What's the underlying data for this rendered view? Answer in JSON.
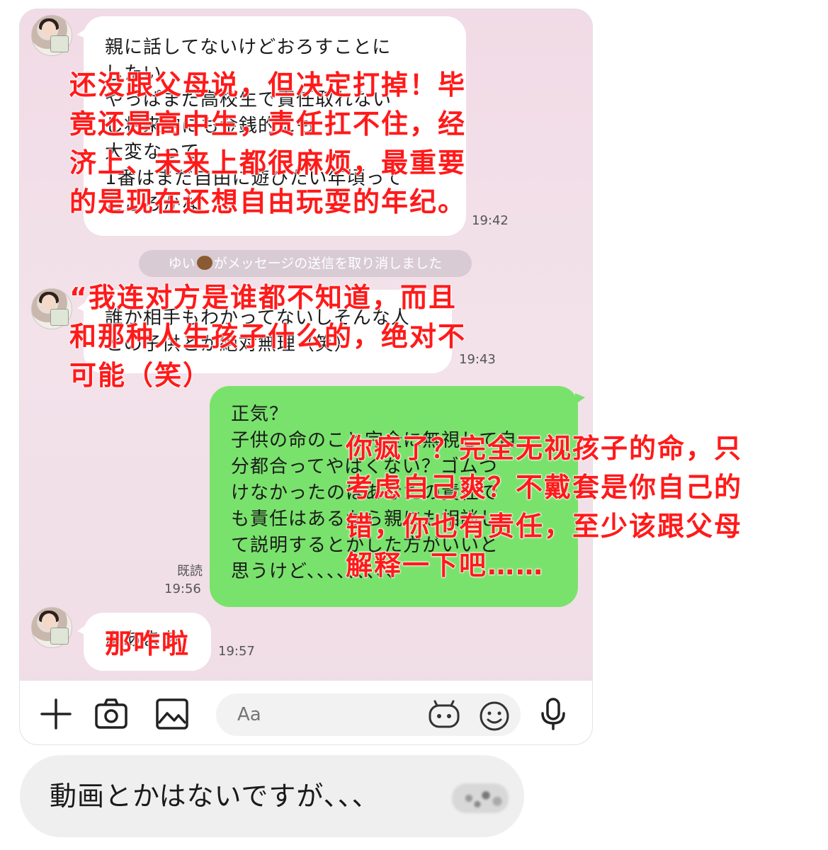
{
  "messages": {
    "m1": {
      "text": "親に話してないけどおろすことに\nしたい\nやっぱまだ高校生で責任取れない\nし将来的にも金銭的にも\n大変なって\n1番はまだ自由に遊びたい年頃って\nところかな",
      "time": "19:42",
      "overlay": "还没跟父母说，但决定打掉！毕\n竟还是高中生，责任扛不住，经\n济上、未来上都很麻烦，最重要\n的是现在还想自由玩耍的年纪。"
    },
    "notice": {
      "name": "ゆい",
      "text": "がメッセージの送信を取り消しました"
    },
    "m2": {
      "text": "誰か相手もわかってないしそんな人\nとの子供とか絶対無理（笑）",
      "time": "19:43",
      "overlay": "“我连对方是谁都不知道，而且\n和那种人生孩子什么的，绝对不\n可能（笑）"
    },
    "m3": {
      "text": "正気？\n子供の命のこと完全に無視して自\n分都合ってやばくない？ゴムつ\nけなかったのはあなたの責任で\nも責任はあるから親にも相談し\nて説明するとかした方がいいと\n思うけど、、、、、、、、、",
      "read_label": "既読",
      "time": "19:56",
      "overlay": "你疯了？完全无视孩子的命，只\n考虑自己爽？不戴套是你自己的\n错，你也有责任，至少该跟父母\n解释一下吧……"
    },
    "m4": {
      "text": "まあまあ",
      "time": "19:57",
      "overlay": "那咋啦"
    }
  },
  "input": {
    "placeholder": "Aa"
  },
  "caption": {
    "text": "動画とかはないですが、、、"
  }
}
